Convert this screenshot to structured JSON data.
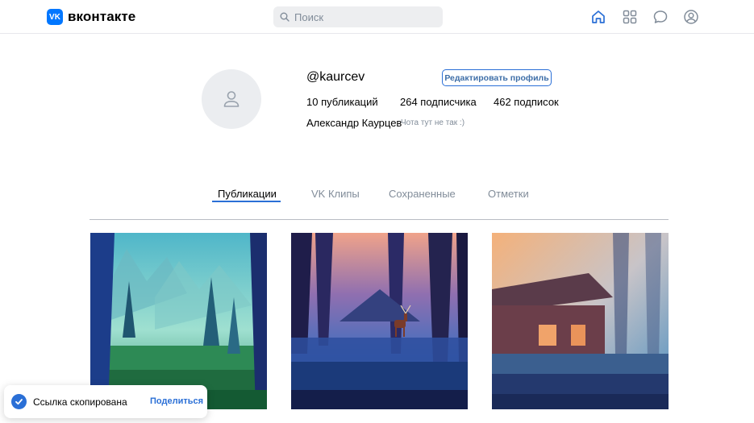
{
  "header": {
    "logo_mark": "VK",
    "logo_text": "вконтакте",
    "search_placeholder": "Поиск",
    "icons": [
      "home-icon",
      "services-grid-icon",
      "messages-icon",
      "profile-icon"
    ],
    "accent": "#0077ff"
  },
  "profile": {
    "username": "@kaurcev",
    "edit_label": "Редактировать профиль",
    "stats": {
      "posts": "10 публикаций",
      "followers": "264 подписчика",
      "following": "462 подписок"
    },
    "full_name": "Александр Каурцев",
    "bio": "Чота тут не так :)"
  },
  "tabs": [
    {
      "label": "Публикации",
      "active": true
    },
    {
      "label": "VK Клипы",
      "active": false
    },
    {
      "label": "Сохраненные",
      "active": false
    },
    {
      "label": "Отметки",
      "active": false
    }
  ],
  "posts": [
    {
      "name": "post-forest-day"
    },
    {
      "name": "post-forest-deer"
    },
    {
      "name": "post-forest-cabin"
    }
  ],
  "toast": {
    "text": "Ссылка скопирована",
    "action": "Поделиться"
  },
  "colors": {
    "link": "#2a6fd6",
    "muted": "#818c99",
    "divider": "#e7e8ec"
  }
}
